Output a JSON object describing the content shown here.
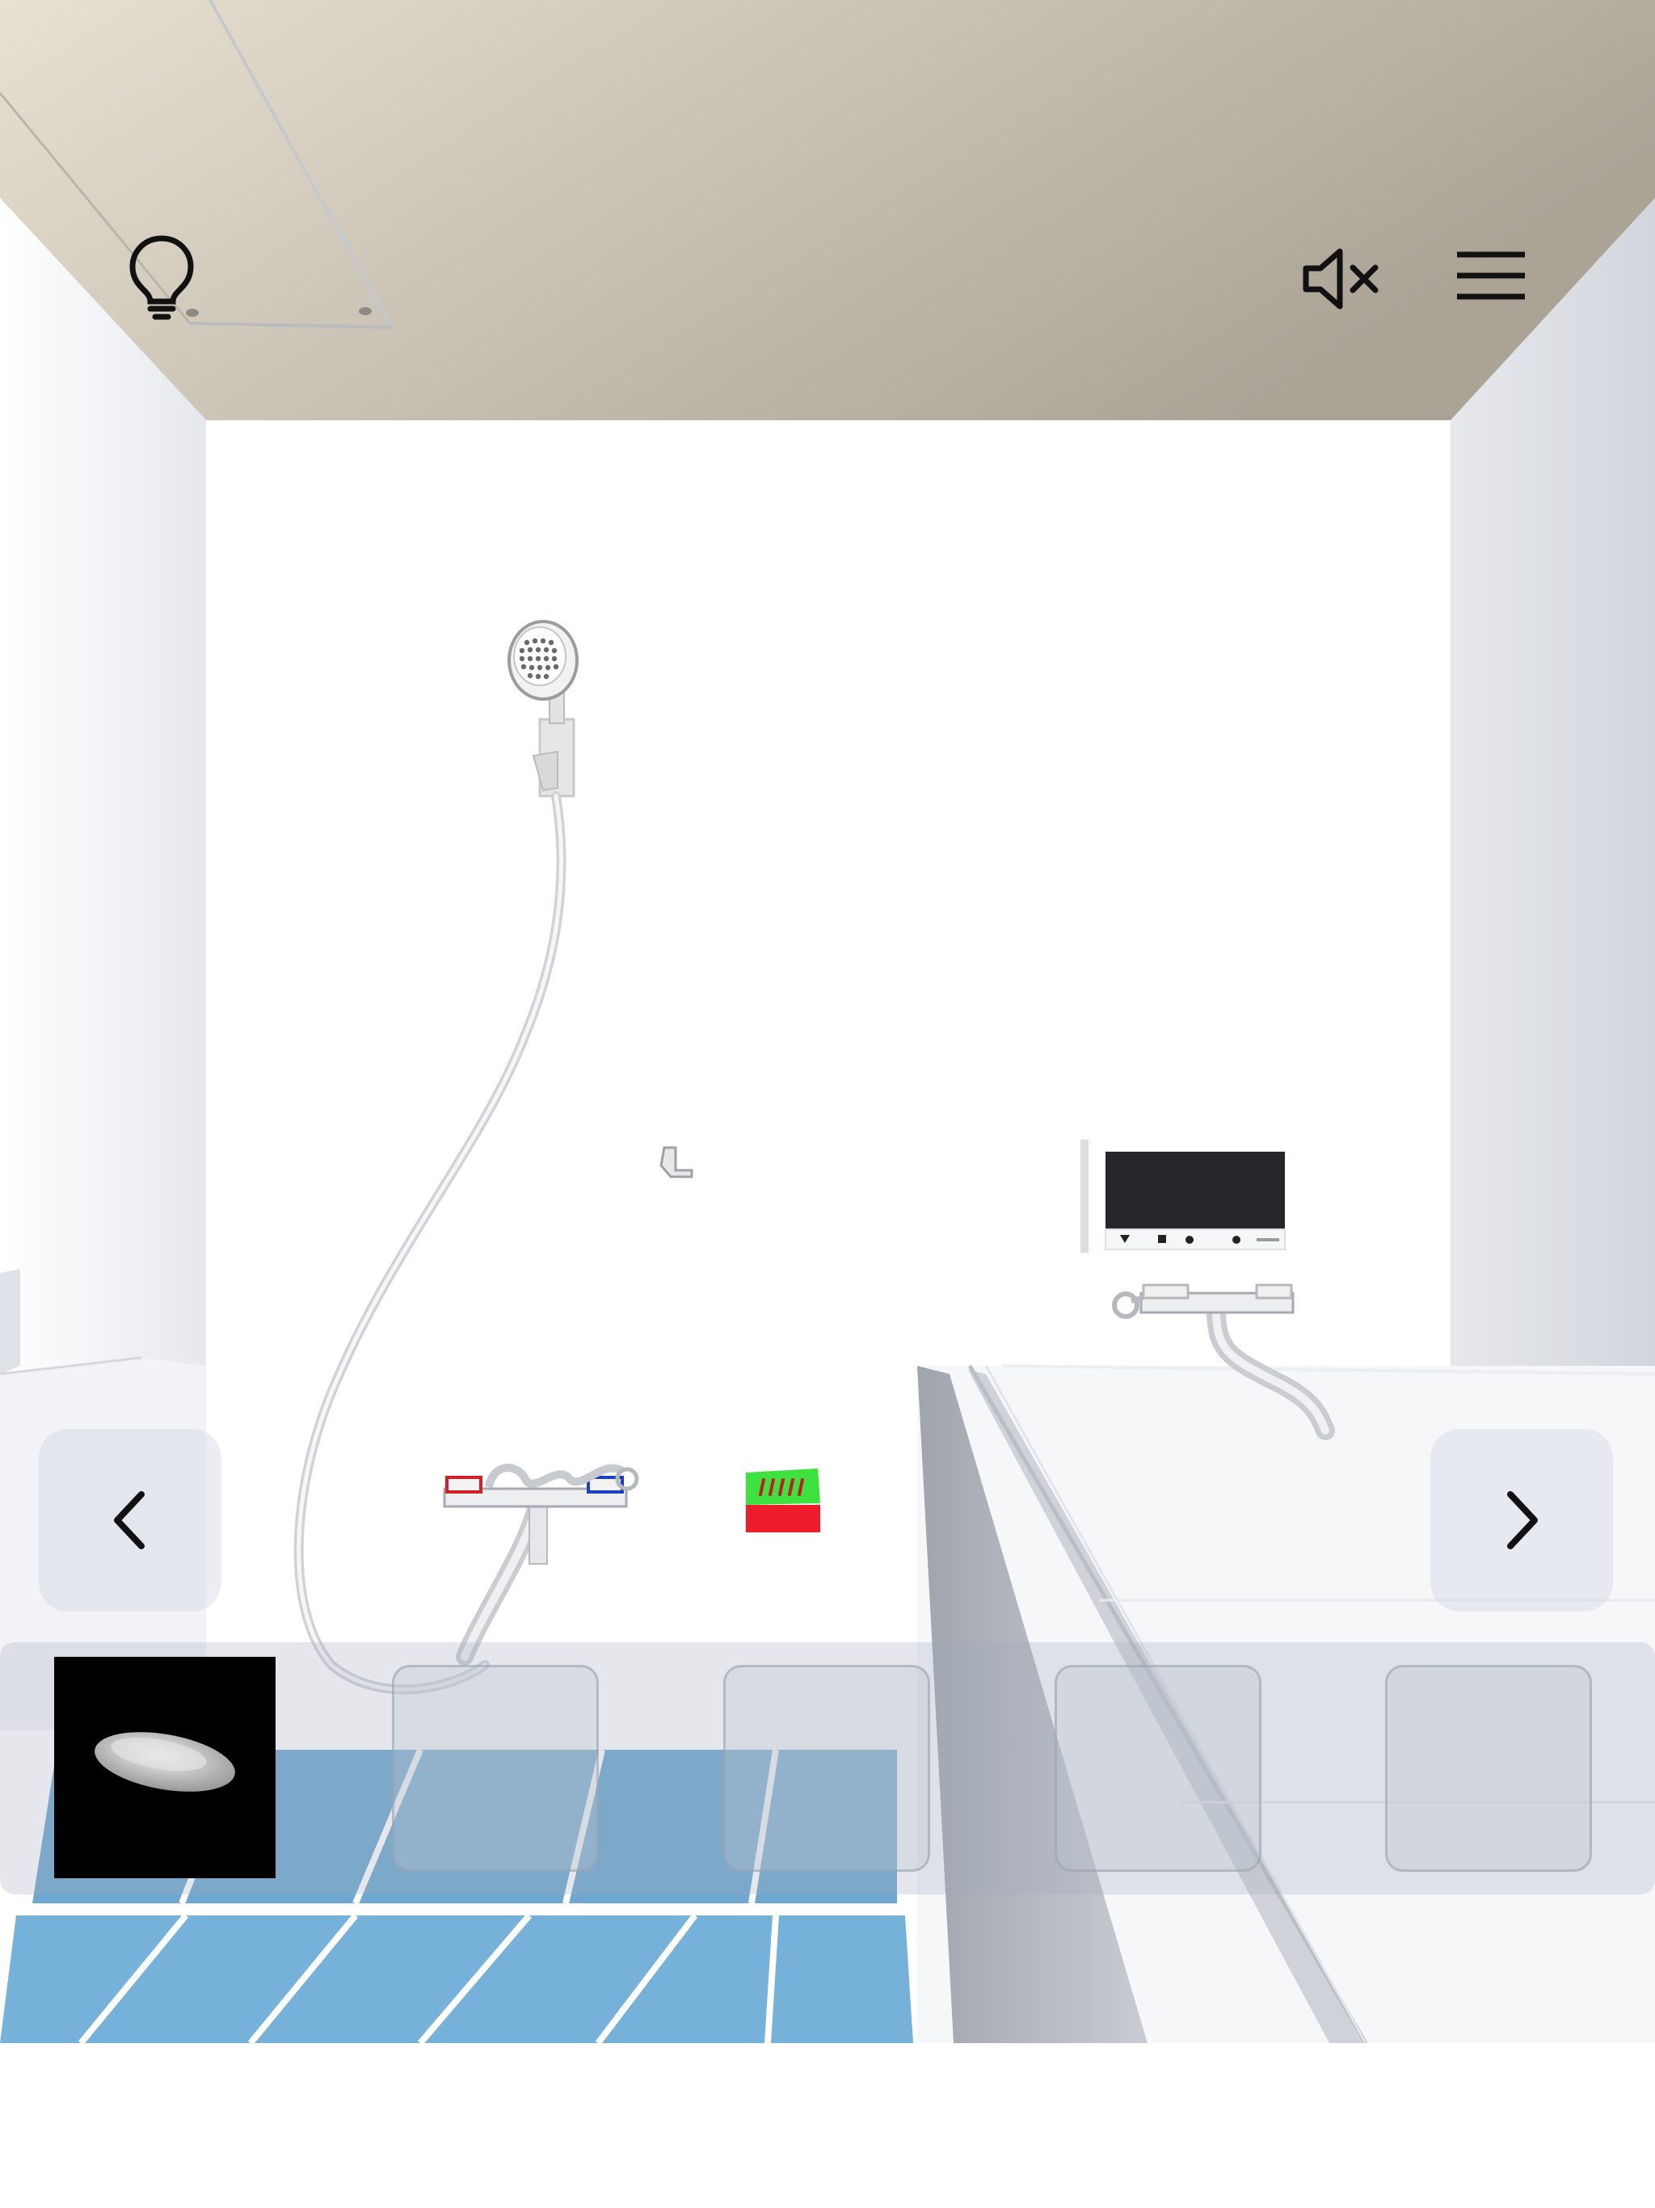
{
  "hud": {
    "hint_icon": "lightbulb-icon",
    "sound_icon": "speaker-muted-icon",
    "menu_icon": "hamburger-menu-icon",
    "prev_icon": "chevron-left-icon",
    "next_icon": "chevron-right-icon"
  },
  "inventory": {
    "slots": [
      {
        "item": "soap-bar-icon",
        "selected": true
      },
      {
        "item": null
      },
      {
        "item": null
      },
      {
        "item": null
      },
      {
        "item": null
      }
    ]
  },
  "scene": {
    "objects": [
      "ceiling-hatch",
      "shower-head",
      "shower-hose",
      "shower-mixer-faucet",
      "red-green-box",
      "wall-hook",
      "control-panel",
      "bath-faucet",
      "bathtub",
      "blue-tile-floor"
    ],
    "colors": {
      "ceiling": "#d6cfc0",
      "wall": "#ffffff",
      "floor_tile": "#6ea8d0",
      "panel_screen": "#25272a",
      "box_green": "#3ee23e",
      "box_red": "#ee1c2a"
    }
  }
}
